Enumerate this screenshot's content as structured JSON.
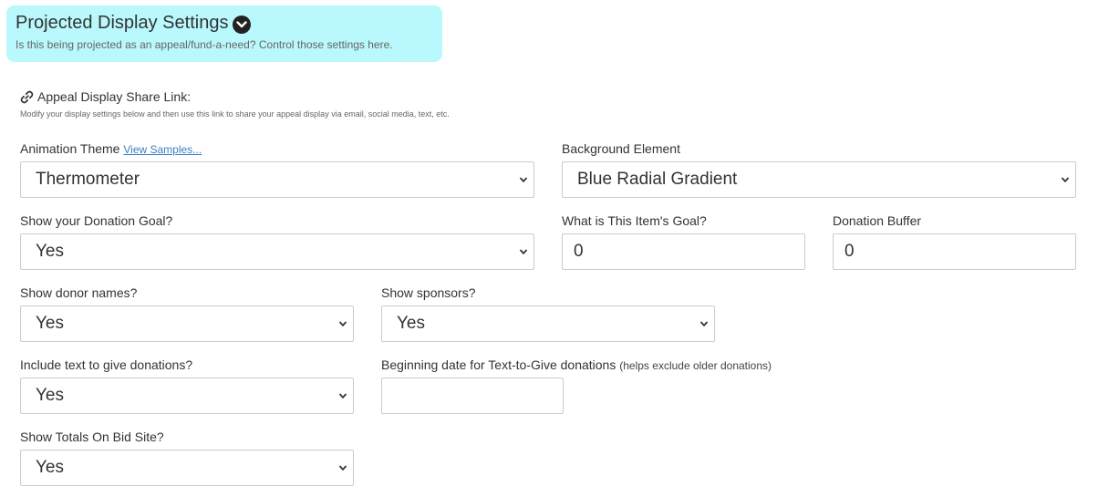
{
  "header": {
    "title": "Projected Display Settings",
    "subtitle": "Is this being projected as an appeal/fund-a-need? Control those settings here.",
    "toggle_icon": "chevron-circle-down-icon",
    "bg_color": "#b9f8fc"
  },
  "share": {
    "icon": "link-icon",
    "title": "Appeal Display Share Link:",
    "description": "Modify your display settings below and then use this link to share your appeal display via email, social media, text, etc."
  },
  "fields": {
    "animation_theme": {
      "label": "Animation Theme",
      "link": "View Samples...",
      "value": "Thermometer"
    },
    "background_element": {
      "label": "Background Element",
      "value": "Blue Radial Gradient"
    },
    "donation_goal": {
      "label": "Show your Donation Goal?",
      "value": "Yes"
    },
    "item_goal": {
      "label": "What is This Item's Goal?",
      "value": "0"
    },
    "donation_buffer": {
      "label": "Donation Buffer",
      "value": "0"
    },
    "donor_names": {
      "label": "Show donor names?",
      "value": "Yes"
    },
    "sponsors": {
      "label": "Show sponsors?",
      "value": "Yes"
    },
    "text_to_give": {
      "label": "Include text to give donations?",
      "value": "Yes"
    },
    "text_to_give_date": {
      "label": "Beginning date for Text-to-Give donations",
      "hint": "(helps exclude older donations)",
      "value": ""
    },
    "totals_on_bid_site": {
      "label": "Show Totals On Bid Site?",
      "value": "Yes"
    }
  },
  "colors": {
    "link": "#3b7dc4",
    "border": "#cccccc",
    "text": "#333333"
  }
}
